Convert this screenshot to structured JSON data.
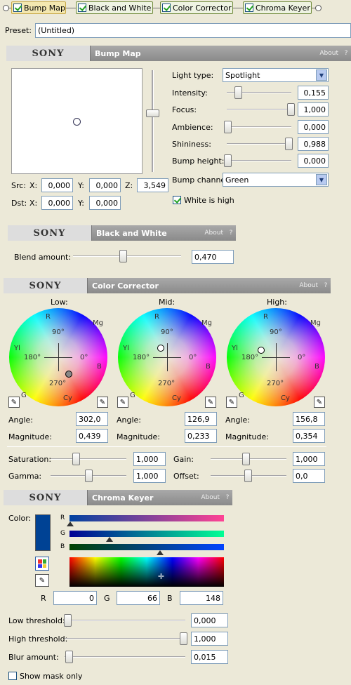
{
  "chain": {
    "tabs": [
      "Bump Map",
      "Black and White",
      "Color Corrector",
      "Chroma Keyer"
    ]
  },
  "preset": {
    "label": "Preset:",
    "value": "(Untitled)"
  },
  "bump_map": {
    "brand": "SONY",
    "title": "Bump Map",
    "about": "About",
    "help": "?",
    "light_type_label": "Light type:",
    "light_type_value": "Spotlight",
    "intensity_label": "Intensity:",
    "intensity_value": "0,155",
    "focus_label": "Focus:",
    "focus_value": "1,000",
    "ambience_label": "Ambience:",
    "ambience_value": "0,000",
    "shininess_label": "Shininess:",
    "shininess_value": "0,988",
    "bump_height_label": "Bump height:",
    "bump_height_value": "0,000",
    "bump_channel_label": "Bump channel:",
    "bump_channel_value": "Green",
    "white_is_high_label": "White is high",
    "src_label": "Src:",
    "dst_label": "Dst:",
    "x_label": "X:",
    "y_label": "Y:",
    "z_label": "Z:",
    "src_x": "0,000",
    "src_y": "0,000",
    "src_z": "3,549",
    "dst_x": "0,000",
    "dst_y": "0,000"
  },
  "black_white": {
    "brand": "SONY",
    "title": "Black and White",
    "about": "About",
    "help": "?",
    "blend_label": "Blend amount:",
    "blend_value": "0,470"
  },
  "color_corrector": {
    "brand": "SONY",
    "title": "Color Corrector",
    "about": "About",
    "help": "?",
    "wheels": [
      {
        "title": "Low:",
        "angle_label": "Angle:",
        "angle": "302,0",
        "magnitude_label": "Magnitude:",
        "magnitude": "0,439"
      },
      {
        "title": "Mid:",
        "angle_label": "Angle:",
        "angle": "126,9",
        "magnitude_label": "Magnitude:",
        "magnitude": "0,233"
      },
      {
        "title": "High:",
        "angle_label": "Angle:",
        "angle": "156,8",
        "magnitude_label": "Magnitude:",
        "magnitude": "0,354"
      }
    ],
    "wheel_labels": {
      "r": "R",
      "mg": "Mg",
      "yl": "Yl",
      "b": "B",
      "g": "G",
      "cy": "Cy",
      "d90": "90°",
      "d180": "180°",
      "d0": "0°",
      "d270": "270°"
    },
    "saturation_label": "Saturation:",
    "saturation_value": "1,000",
    "gain_label": "Gain:",
    "gain_value": "1,000",
    "gamma_label": "Gamma:",
    "gamma_value": "1,000",
    "offset_label": "Offset:",
    "offset_value": "0,0"
  },
  "chroma_keyer": {
    "brand": "SONY",
    "title": "Chroma Keyer",
    "about": "About",
    "help": "?",
    "color_label": "Color:",
    "swatch_color": "#004294",
    "r_label": "R",
    "g_label": "G",
    "b_label": "B",
    "r_value": "0",
    "g_value": "66",
    "b_value": "148",
    "low_threshold_label": "Low threshold:",
    "low_threshold_value": "0,000",
    "high_threshold_label": "High threshold:",
    "high_threshold_value": "1,000",
    "blur_label": "Blur amount:",
    "blur_value": "0,015",
    "show_mask_label": "Show mask only"
  }
}
